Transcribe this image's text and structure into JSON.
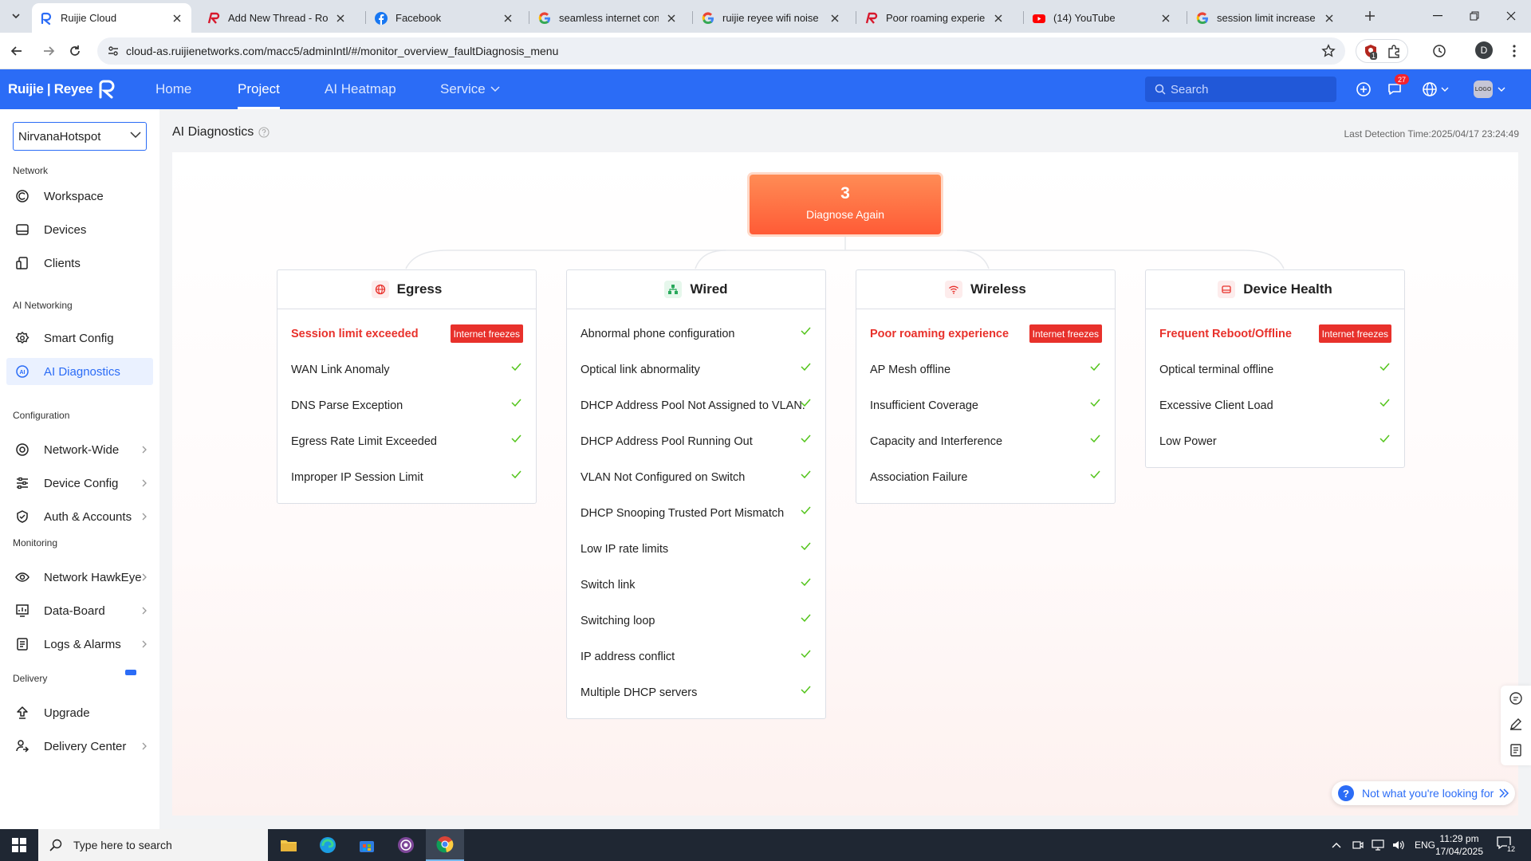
{
  "browser": {
    "tabs": [
      {
        "title": "Ruijie Cloud",
        "active": true,
        "icon": "ruijie-icon"
      },
      {
        "title": "Add New Thread - Router",
        "active": false,
        "icon": "ruijie-r-icon"
      },
      {
        "title": "Facebook",
        "active": false,
        "icon": "facebook-icon"
      },
      {
        "title": "seamless internet connect",
        "active": false,
        "icon": "google-icon"
      },
      {
        "title": "ruijie reyee wifi noise leve",
        "active": false,
        "icon": "google-icon"
      },
      {
        "title": "Poor roaming experience",
        "active": false,
        "icon": "ruijie-r-icon"
      },
      {
        "title": "(14) YouTube",
        "active": false,
        "icon": "youtube-icon"
      },
      {
        "title": "session limit increase to w",
        "active": false,
        "icon": "google-icon"
      }
    ],
    "url": "cloud-as.ruijienetworks.com/macc5/adminIntl/#/monitor_overview_faultDiagnosis_menu",
    "extension_badge": "1",
    "profile_initial": "D"
  },
  "header": {
    "logo_text": "Ruijie | Reyee",
    "nav": [
      {
        "label": "Home",
        "active": false
      },
      {
        "label": "Project",
        "active": true
      },
      {
        "label": "AI Heatmap",
        "active": false
      },
      {
        "label": "Service",
        "active": false
      }
    ],
    "search_placeholder": "Search",
    "message_count": "27",
    "avatar_text": "LOGO",
    "brand_color": "#2b6cf6"
  },
  "sidebar": {
    "site": "NirvanaHotspot",
    "sections": [
      {
        "title": "Network",
        "items": [
          {
            "label": "Workspace",
            "icon": "workspace-icon"
          },
          {
            "label": "Devices",
            "icon": "devices-icon"
          },
          {
            "label": "Clients",
            "icon": "clients-icon"
          }
        ]
      },
      {
        "title": "AI Networking",
        "items": [
          {
            "label": "Smart Config",
            "icon": "smart-config-icon"
          },
          {
            "label": "AI Diagnostics",
            "icon": "ai-diagnostics-icon",
            "active": true
          }
        ]
      },
      {
        "title": "Configuration",
        "items": [
          {
            "label": "Network-Wide",
            "icon": "network-wide-icon",
            "expandable": true
          },
          {
            "label": "Device Config",
            "icon": "device-config-icon",
            "expandable": true
          },
          {
            "label": "Auth & Accounts",
            "icon": "auth-icon",
            "expandable": true
          }
        ]
      },
      {
        "title": "Monitoring",
        "items": [
          {
            "label": "Network HawkEye",
            "icon": "hawkeye-icon",
            "expandable": true
          },
          {
            "label": "Data-Board",
            "icon": "data-board-icon",
            "expandable": true
          },
          {
            "label": "Logs & Alarms",
            "icon": "logs-icon",
            "expandable": true
          }
        ]
      },
      {
        "title": "Delivery",
        "items": [
          {
            "label": "Upgrade",
            "icon": "upgrade-icon"
          },
          {
            "label": "Delivery Center",
            "icon": "delivery-center-icon",
            "expandable": true
          }
        ]
      }
    ]
  },
  "main": {
    "title": "AI Diagnostics",
    "last_detection": "Last Detection Time:2025/04/17 23:24:49",
    "diagnose": {
      "count": "3",
      "label": "Diagnose Again"
    },
    "issue_tag": "Internet freezes",
    "status_ok_color": "#52c41a",
    "status_issue_color": "#e8312b",
    "cards": [
      {
        "title": "Egress",
        "icon": "globe-icon",
        "items": [
          {
            "label": "Session limit exceeded",
            "issue": true
          },
          {
            "label": "WAN Link Anomaly",
            "issue": false
          },
          {
            "label": "DNS Parse Exception",
            "issue": false
          },
          {
            "label": "Egress Rate Limit Exceeded",
            "issue": false
          },
          {
            "label": "Improper IP Session Limit",
            "issue": false
          }
        ]
      },
      {
        "title": "Wired",
        "icon": "network-tree-icon",
        "items": [
          {
            "label": "Abnormal phone configuration",
            "issue": false
          },
          {
            "label": "Optical link abnormality",
            "issue": false
          },
          {
            "label": "DHCP Address Pool Not Assigned to VLAN.",
            "issue": false
          },
          {
            "label": "DHCP Address Pool Running Out",
            "issue": false
          },
          {
            "label": "VLAN Not Configured on Switch",
            "issue": false
          },
          {
            "label": "DHCP Snooping Trusted Port Mismatch",
            "issue": false
          },
          {
            "label": "Low IP rate limits",
            "issue": false
          },
          {
            "label": "Switch link",
            "issue": false
          },
          {
            "label": "Switching loop",
            "issue": false
          },
          {
            "label": "IP address conflict",
            "issue": false
          },
          {
            "label": "Multiple DHCP servers",
            "issue": false
          }
        ]
      },
      {
        "title": "Wireless",
        "icon": "wifi-icon",
        "items": [
          {
            "label": "Poor roaming experience",
            "issue": true
          },
          {
            "label": "AP Mesh offline",
            "issue": false
          },
          {
            "label": "Insufficient Coverage",
            "issue": false
          },
          {
            "label": "Capacity and Interference",
            "issue": false
          },
          {
            "label": "Association Failure",
            "issue": false
          }
        ]
      },
      {
        "title": "Device Health",
        "icon": "device-health-icon",
        "items": [
          {
            "label": "Frequent Reboot/Offline",
            "issue": true
          },
          {
            "label": "Optical terminal offline",
            "issue": false
          },
          {
            "label": "Excessive Client Load",
            "issue": false
          },
          {
            "label": "Low Power",
            "issue": false
          }
        ]
      }
    ],
    "help_link": "Not what you're looking for"
  },
  "taskbar": {
    "search_placeholder": "Type here to search",
    "lang": "ENG",
    "time": "11:29 pm",
    "date": "17/04/2025",
    "notifications": "12"
  }
}
